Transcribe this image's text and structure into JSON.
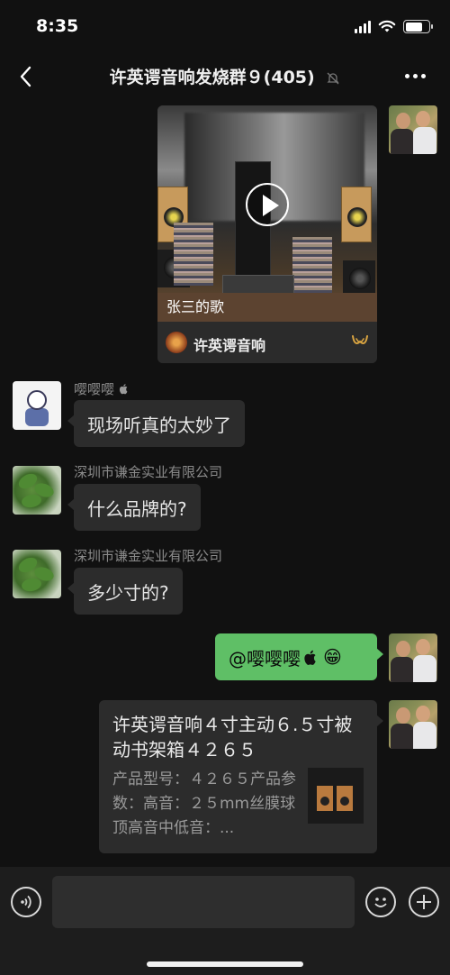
{
  "status_bar": {
    "time": "8:35"
  },
  "nav": {
    "title": "许英谔音响发烧群９(405)"
  },
  "video_card": {
    "caption": "张三的歌",
    "channel": "许英谔音响"
  },
  "messages": [
    {
      "sender": "嘤嘤嘤",
      "text": "现场听真的太妙了"
    },
    {
      "sender": "深圳市谦金实业有限公司",
      "text": "什么品牌的?"
    },
    {
      "sender": "深圳市谦金实业有限公司",
      "text": "多少寸的?"
    }
  ],
  "my_mention": {
    "text": "@嘤嘤嘤",
    "emoji": "😁"
  },
  "link_card": {
    "title": "许英谔音响４寸主动６.５寸被动书架箱４２６５",
    "description": "产品型号：４２６５产品参数：高音：２５mm丝膜球顶高音中低音：..."
  },
  "input": {
    "placeholder": ""
  },
  "icons": {
    "back": "chevron-left-icon",
    "mute": "bell-slash-icon",
    "more": "more-dots-icon",
    "play": "play-icon",
    "voice": "voice-icon",
    "emoji": "emoji-icon",
    "plus": "plus-icon"
  },
  "colors": {
    "background": "#111111",
    "bubble": "#2c2c2c",
    "my_bubble": "#5fbf66",
    "input_bar": "#1d1d1d"
  }
}
